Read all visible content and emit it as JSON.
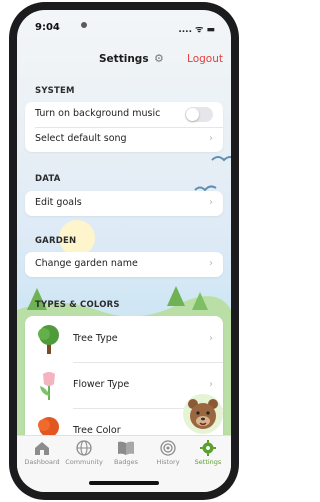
{
  "status": {
    "time": "9:04",
    "indicators": ".... ᯤ ▬"
  },
  "header": {
    "title": "Settings",
    "title_icon": "gear-icon",
    "logout_label": "Logout"
  },
  "sections": {
    "system": {
      "label": "SYSTEM",
      "items": [
        {
          "label": "Turn on background music",
          "type": "toggle",
          "on": false
        },
        {
          "label": "Select default song",
          "type": "link"
        }
      ]
    },
    "data": {
      "label": "DATA",
      "items": [
        {
          "label": "Edit goals"
        }
      ]
    },
    "garden": {
      "label": "GARDEN",
      "items": [
        {
          "label": "Change garden name"
        }
      ]
    },
    "types_colors": {
      "label": "TYPES & COLORS",
      "items": [
        {
          "label": "Tree Type",
          "icon": "tree-icon"
        },
        {
          "label": "Flower Type",
          "icon": "tulip-icon"
        },
        {
          "label": "Tree Color",
          "icon": "orange-tree-icon"
        }
      ]
    }
  },
  "tabs": [
    {
      "label": "Dashboard",
      "icon": "home-icon",
      "active": false
    },
    {
      "label": "Community",
      "icon": "globe-icon",
      "active": false
    },
    {
      "label": "Badges",
      "icon": "book-icon",
      "active": false
    },
    {
      "label": "History",
      "icon": "target-icon",
      "active": false
    },
    {
      "label": "Settings",
      "icon": "gear-icon",
      "active": true
    }
  ],
  "colors": {
    "accent": "#5aa02c",
    "logout": "#e23e3e"
  }
}
